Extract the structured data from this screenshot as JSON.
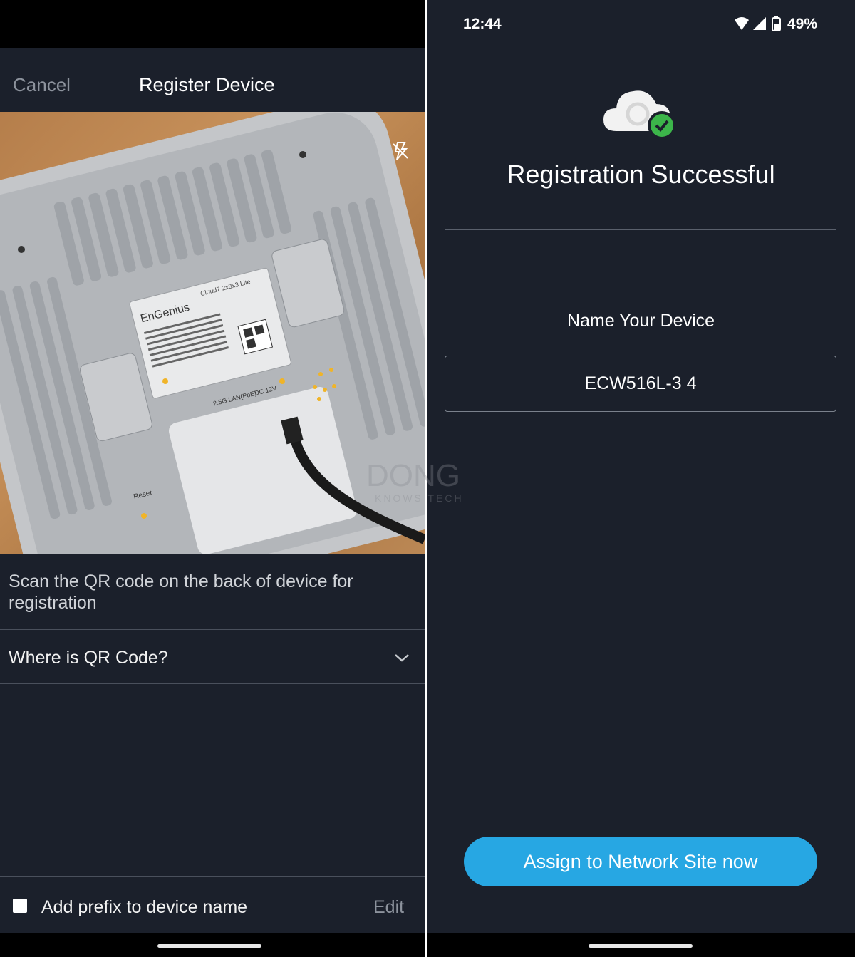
{
  "left": {
    "cancel_label": "Cancel",
    "title": "Register Device",
    "scan_instruction": "Scan the QR code on the back of device for registration",
    "qr_help_label": "Where is QR Code?",
    "prefix_label": "Add prefix to device name",
    "edit_label": "Edit",
    "camera": {
      "brand_label": "EnGenius",
      "model_label": "Cloud7 2x3x3 Lite",
      "port_lan_label": "2.5G LAN(PoE)",
      "port_dc_label": "DC 12V",
      "reset_label": "Reset"
    }
  },
  "right": {
    "status_time": "12:44",
    "battery_percent": "49%",
    "success_title": "Registration Successful",
    "name_label": "Name Your Device",
    "device_name_value": "ECW516L-3 4",
    "assign_button": "Assign to Network Site now"
  },
  "watermark": {
    "line1": "DONG",
    "line2": "KNOWS TECH"
  },
  "colors": {
    "background": "#1b202b",
    "accent_button": "#27a7e3",
    "success_check": "#3cb54a",
    "muted_text": "#8c929c"
  },
  "icons": [
    "flash-off-icon",
    "chevron-down-icon",
    "wifi-icon",
    "signal-icon",
    "battery-icon",
    "cloud-success-icon"
  ]
}
